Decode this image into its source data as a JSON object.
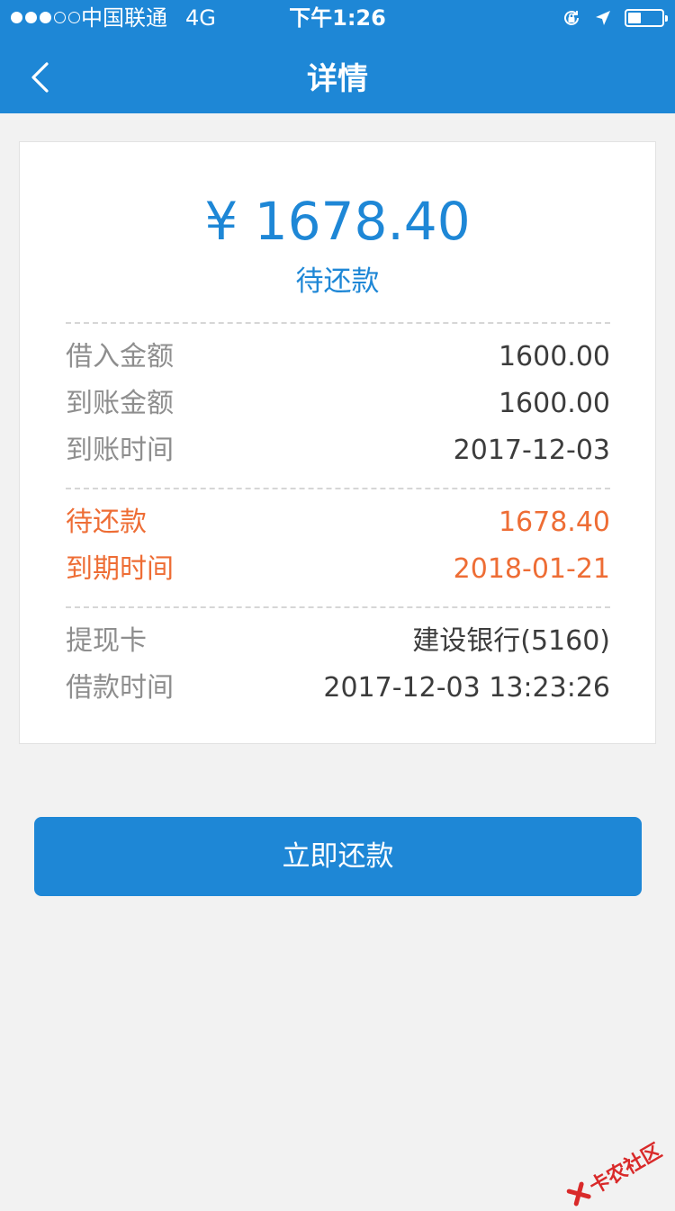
{
  "status_bar": {
    "carrier": "中国联通",
    "network": "4G",
    "time": "下午1:26",
    "signal_bars_filled": 3,
    "signal_bars_total": 5,
    "battery_level": 0.45
  },
  "nav": {
    "title": "详情",
    "back_icon": "chevron-left-icon"
  },
  "summary": {
    "amount": "¥ 1678.40",
    "status": "待还款"
  },
  "loan_info": [
    {
      "label": "借入金额",
      "value": "1600.00"
    },
    {
      "label": "到账金额",
      "value": "1600.00"
    },
    {
      "label": "到账时间",
      "value": "2017-12-03"
    }
  ],
  "repayment_info": [
    {
      "label": "待还款",
      "value": "1678.40"
    },
    {
      "label": "到期时间",
      "value": "2018-01-21"
    }
  ],
  "account_info": [
    {
      "label": "提现卡",
      "value": "建设银行(5160)"
    },
    {
      "label": "借款时间",
      "value": "2017-12-03 13:23:26"
    }
  ],
  "actions": {
    "repay_label": "立即还款"
  },
  "watermark": {
    "text": "卡农社区"
  },
  "colors": {
    "primary": "#1e87d6",
    "warning": "#ee6d35",
    "background": "#f2f2f2"
  }
}
